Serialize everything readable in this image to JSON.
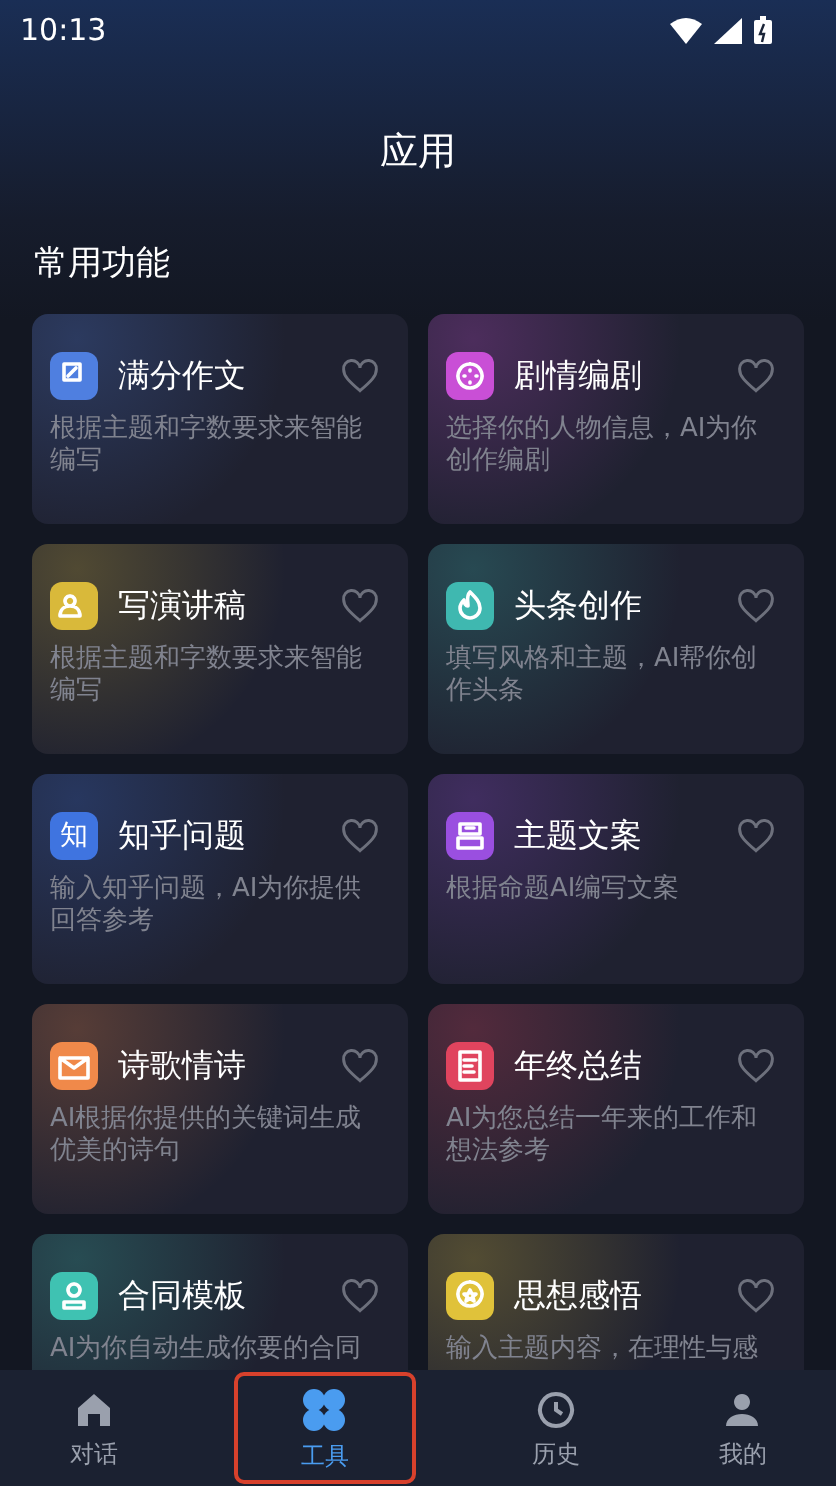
{
  "status_bar": {
    "time": "10:13"
  },
  "header": {
    "title": "应用"
  },
  "section": {
    "title": "常用功能"
  },
  "cards": [
    {
      "title": "满分作文",
      "description": "根据主题和字数要求来智能编写",
      "color": "#4f7fe0",
      "favorited": false
    },
    {
      "title": "剧情编剧",
      "description": "选择你的人物信息，AI为你创作编剧",
      "color": "#c94fd6",
      "favorited": false
    },
    {
      "title": "写演讲稿",
      "description": "根据主题和字数要求来智能编写",
      "color": "#d9b93a",
      "favorited": false
    },
    {
      "title": "头条创作",
      "description": "填写风格和主题，AI帮你创作头条",
      "color": "#3fb8b0",
      "favorited": false
    },
    {
      "title": "知乎问题",
      "description": "输入知乎问题，AI为你提供回答参考",
      "color": "#3f74e0",
      "favorited": false,
      "badge_text": "知"
    },
    {
      "title": "主题文案",
      "description": "根据命题AI编写文案",
      "color": "#9a4fe0",
      "favorited": false
    },
    {
      "title": "诗歌情诗",
      "description": "AI根据你提供的关键词生成优美的诗句",
      "color": "#f0894a",
      "favorited": false
    },
    {
      "title": "年终总结",
      "description": "AI为您总结一年来的工作和想法参考",
      "color": "#e0445e",
      "favorited": false
    },
    {
      "title": "合同模板",
      "description": "AI为你自动生成你要的合同",
      "color": "#3fc2b2",
      "favorited": false
    },
    {
      "title": "思想感悟",
      "description": "输入主题内容，在理性与感",
      "color": "#e0c23a",
      "favorited": false
    }
  ],
  "tabs": [
    {
      "label": "对话",
      "selected": false
    },
    {
      "label": "工具",
      "selected": true
    },
    {
      "label": "历史",
      "selected": false
    },
    {
      "label": "我的",
      "selected": false
    }
  ]
}
